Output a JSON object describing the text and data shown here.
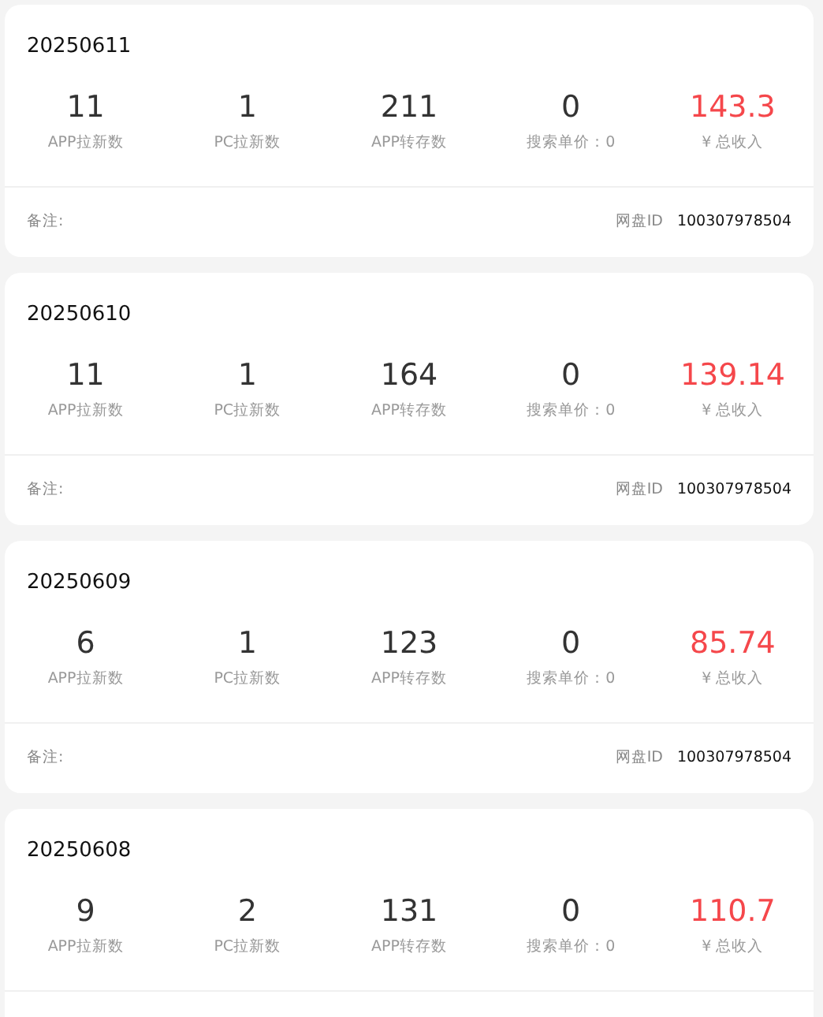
{
  "records": [
    {
      "date": "20250611",
      "stats": [
        {
          "kind": "count",
          "value": "11",
          "label": "APP拉新数"
        },
        {
          "kind": "count",
          "value": "1",
          "label": "PC拉新数"
        },
        {
          "kind": "count",
          "value": "211",
          "label": "APP转存数"
        },
        {
          "kind": "count",
          "value": "0",
          "label": "搜索单价：0"
        },
        {
          "kind": "income",
          "value": "143.3",
          "label": "¥ 总收入"
        }
      ],
      "footer": {
        "note_label": "备注:",
        "id_label": "网盘ID",
        "id_value": "100307978504"
      }
    },
    {
      "date": "20250610",
      "stats": [
        {
          "kind": "count",
          "value": "11",
          "label": "APP拉新数"
        },
        {
          "kind": "count",
          "value": "1",
          "label": "PC拉新数"
        },
        {
          "kind": "count",
          "value": "164",
          "label": "APP转存数"
        },
        {
          "kind": "count",
          "value": "0",
          "label": "搜索单价：0"
        },
        {
          "kind": "income",
          "value": "139.14",
          "label": "¥ 总收入"
        }
      ],
      "footer": {
        "note_label": "备注:",
        "id_label": "网盘ID",
        "id_value": "100307978504"
      }
    },
    {
      "date": "20250609",
      "stats": [
        {
          "kind": "count",
          "value": "6",
          "label": "APP拉新数"
        },
        {
          "kind": "count",
          "value": "1",
          "label": "PC拉新数"
        },
        {
          "kind": "count",
          "value": "123",
          "label": "APP转存数"
        },
        {
          "kind": "count",
          "value": "0",
          "label": "搜索单价：0"
        },
        {
          "kind": "income",
          "value": "85.74",
          "label": "¥ 总收入"
        }
      ],
      "footer": {
        "note_label": "备注:",
        "id_label": "网盘ID",
        "id_value": "100307978504"
      }
    },
    {
      "date": "20250608",
      "stats": [
        {
          "kind": "count",
          "value": "9",
          "label": "APP拉新数"
        },
        {
          "kind": "count",
          "value": "2",
          "label": "PC拉新数"
        },
        {
          "kind": "count",
          "value": "131",
          "label": "APP转存数"
        },
        {
          "kind": "count",
          "value": "0",
          "label": "搜索单价：0"
        },
        {
          "kind": "income",
          "value": "110.7",
          "label": "¥ 总收入"
        }
      ]
    }
  ]
}
